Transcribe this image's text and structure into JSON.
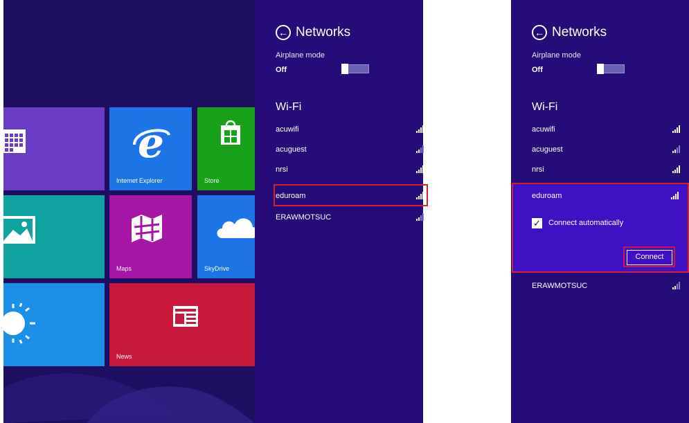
{
  "left": {
    "tiles": [
      {
        "id": "calendar",
        "label": "",
        "color": "#6a3cc6",
        "icon": "calendar-icon"
      },
      {
        "id": "ie",
        "label": "Internet Explorer",
        "color": "#1c74e6",
        "icon": "internet-explorer-icon"
      },
      {
        "id": "store",
        "label": "Store",
        "color": "#1aa11a",
        "icon": "store-bag-icon"
      },
      {
        "id": "photos",
        "label": "",
        "color": "#0ea3a1",
        "icon": "photos-icon"
      },
      {
        "id": "maps",
        "label": "Maps",
        "color": "#a615a6",
        "icon": "maps-icon"
      },
      {
        "id": "skydrive",
        "label": "SkyDrive",
        "color": "#1c74e6",
        "icon": "cloud-icon"
      },
      {
        "id": "weather",
        "label": "",
        "color": "#1c8fe8",
        "icon": "sun-icon"
      },
      {
        "id": "news",
        "label": "News",
        "color": "#c8193c",
        "icon": "news-icon"
      }
    ],
    "panel": {
      "title": "Networks",
      "airplane_label": "Airplane mode",
      "airplane_value": "Off",
      "wifi_heading": "Wi-Fi",
      "networks": [
        "acuwifi",
        "acuguest",
        "nrsi",
        "eduroam",
        "ERAWMOTSUC"
      ]
    }
  },
  "right": {
    "panel": {
      "title": "Networks",
      "airplane_label": "Airplane mode",
      "airplane_value": "Off",
      "wifi_heading": "Wi-Fi",
      "networks": [
        "acuwifi",
        "acuguest",
        "nrsi",
        "eduroam",
        "ERAWMOTSUC"
      ],
      "auto_connect_label": "Connect automatically",
      "connect_label": "Connect"
    }
  },
  "colors": {
    "panel_bg": "#260c78",
    "start_bg": "#1d0e60",
    "highlight": "#d7202e",
    "selected_network_bg": "#4010c4"
  }
}
